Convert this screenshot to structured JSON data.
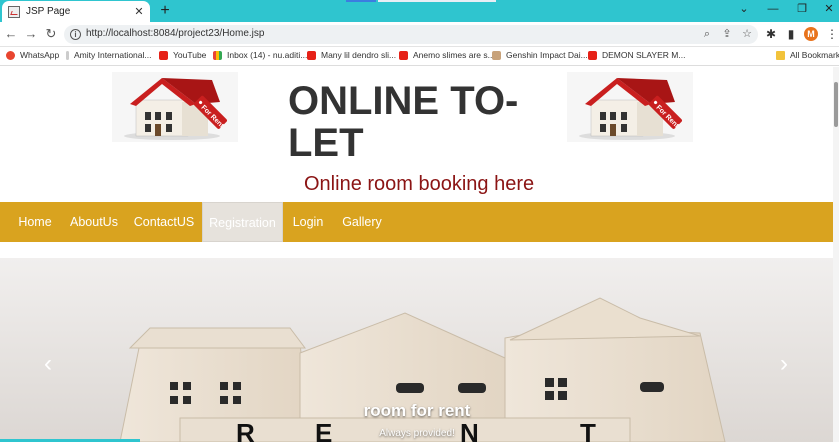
{
  "browser": {
    "tab_title": "JSP Page",
    "tab_close": "✕",
    "new_tab": "+",
    "url": "http://localhost:8084/project23/Home.jsp",
    "controls": {
      "dropdown": "⌄",
      "minimize": "—",
      "restore": "❐",
      "close": "✕"
    },
    "nav": {
      "back": "←",
      "forward": "→",
      "reload": "↻"
    },
    "avatar_initial": "M",
    "bookmarks": [
      {
        "label": "WhatsApp",
        "icon": "whatsapp-icon"
      },
      {
        "label": "Amity International...",
        "icon": "bookmark-icon"
      },
      {
        "label": "YouTube",
        "icon": "youtube-icon"
      },
      {
        "label": "Inbox (14) - nu.aditi...",
        "icon": "gmail-icon"
      },
      {
        "label": "Many lil dendro sli...",
        "icon": "youtube-icon"
      },
      {
        "label": "Anemo slimes are s...",
        "icon": "youtube-icon"
      },
      {
        "label": "Genshin Impact Dai...",
        "icon": "genshin-icon"
      },
      {
        "label": "DEMON SLAYER M...",
        "icon": "youtube-icon"
      }
    ],
    "all_bookmarks": "All Bookmarks"
  },
  "site": {
    "title": "ONLINE TO-LET",
    "tagline": "Online room booking here",
    "logo_sign_text": "For Rent",
    "nav_items": [
      {
        "label": "Home"
      },
      {
        "label": "AboutUs"
      },
      {
        "label": "ContactUS"
      },
      {
        "label": "Registration",
        "active": true
      },
      {
        "label": "Login"
      },
      {
        "label": "Gallery"
      }
    ],
    "carousel": {
      "caption_title": "room for rent",
      "caption_text": "Always provided!",
      "prev": "‹",
      "next": "›"
    }
  },
  "colors": {
    "tabbar": "#2fc5cf",
    "navbar": "#d9a31f",
    "tagline": "#8b1414",
    "active_nav": "#e6e2dc"
  }
}
